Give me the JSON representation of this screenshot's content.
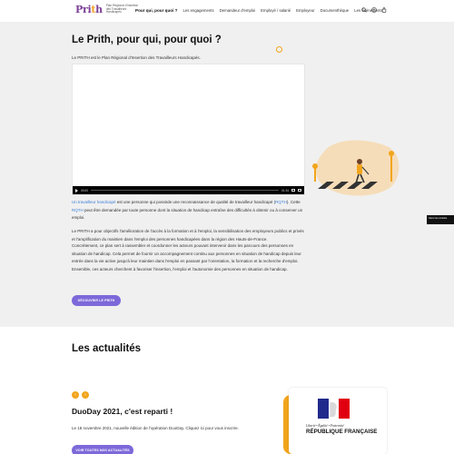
{
  "header": {
    "logo": {
      "word_a": "Pri",
      "word_o": "t",
      "word_b": "h",
      "tagline": "Plan Régional d'Insertion des Travailleurs Handicapés"
    },
    "nav": [
      "Pour qui, pour quoi ?",
      "Les engagements",
      "Demandeur d'emploi",
      "Employé / salarié",
      "Employeur",
      "Documenthèque",
      "Les évènements"
    ],
    "active_nav_index": 0,
    "icons": [
      "search-icon",
      "accessibility-icon",
      "cart-icon"
    ]
  },
  "hero": {
    "title": "Le Prith, pour qui, pour quoi ?",
    "intro": "Le PRITH est le Plan Régional d'Insertion des Travailleurs Handicapés.",
    "video": {
      "time_current": "00:00",
      "time_total": "01:34",
      "progress": 0.0
    },
    "para1": {
      "link1": "Un travailleur handicapé",
      "text1": " est une personne qui possède une reconnaissance de qualité de travailleur handicapé (",
      "link2": "RQTH",
      "text2": "). Cette ",
      "link3": "RQTH",
      "text3": " peut être demandée par toute personne dont la situation de handicap entraîne des difficultés à obtenir ou à conserver un emploi."
    },
    "para2": "Le PRITH a pour objectifs l'amélioration de l'accès à la formation et à l'emploi, la sensibilisation des employeurs publics et privés et l'amplification du maintien dans l'emploi des personnes handicapées dans la région des Hauts-de-France.",
    "para3": "Concrètement, ce plan sert à rassembler et coordonner les acteurs pouvant intervenir dans les parcours des personnes en situation de handicap. Cela permet de fournir un accompagnement continu aux personnes en situation de handicap depuis leur entrée dans la vie active jusqu'à leur maintien dans l'emploi en passant par l'orientation, la formation et la recherche d'emploi. Ensemble, ces acteurs cherchent à favoriser l'insertion, l'emploi et l'autonomie des personnes en situation de handicap.",
    "button": "DÉCOUVRIR LE PRITH",
    "side_badge": "Gérer les cookies"
  },
  "news": {
    "title": "Les actualités",
    "prev_arrow": "‹",
    "next_arrow": "›",
    "article_title": "DuoDay 2021, c'est reparti !",
    "article_text": "Le 18 novembre 2021, nouvelle édition de l'opération DuoDay. Cliquez ici pour vous inscrire.",
    "button": "VOIR TOUTES NOS ACTUALITÉS",
    "card": {
      "motto": "Liberté • Égalité • Fraternité",
      "name": "RÉPUBLIQUE FRANÇAISE"
    }
  },
  "colors": {
    "brand_purple": "#7b3f98",
    "accent_orange": "#f2a51c",
    "button_purple": "#7d69d9",
    "link_blue": "#3d7ed8",
    "section_grey": "#f0f0f0"
  }
}
